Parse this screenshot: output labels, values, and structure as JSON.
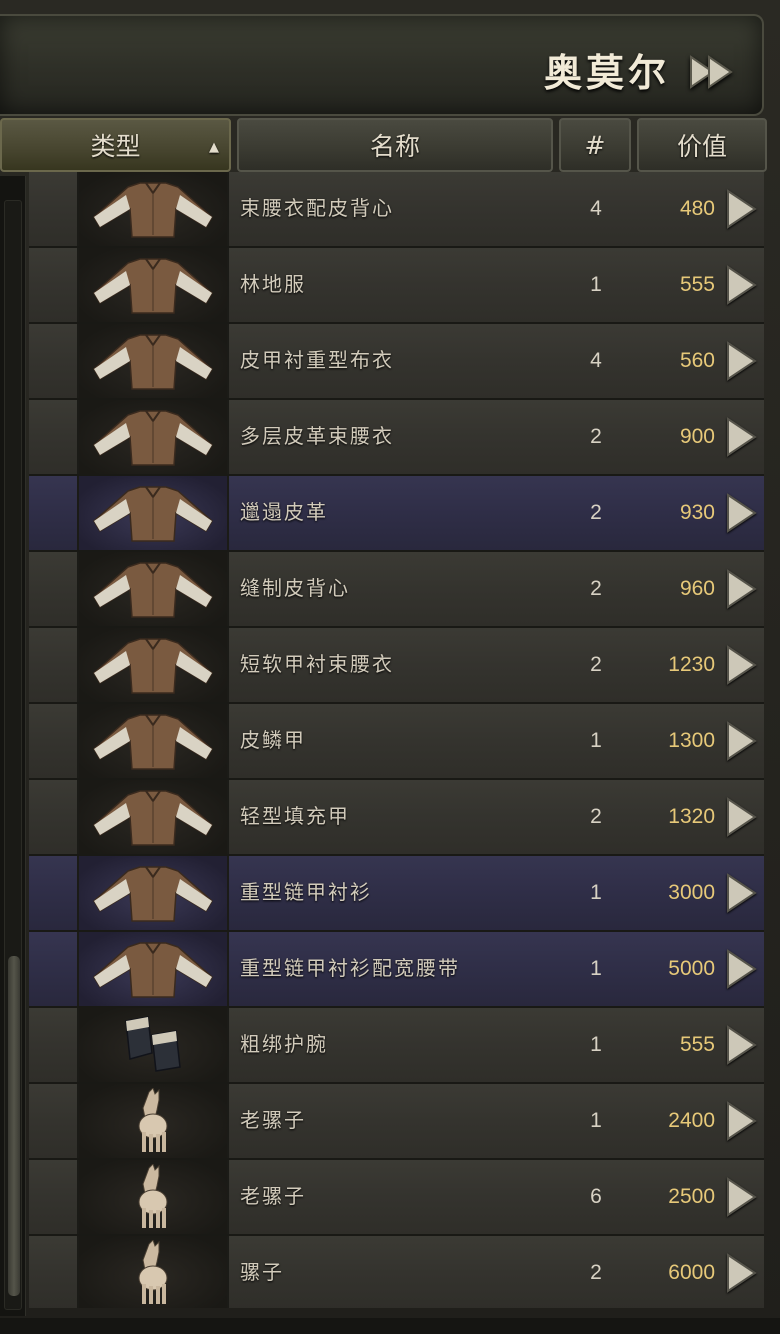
{
  "merchant": {
    "name": "奥莫尔"
  },
  "columns": {
    "type": "类型",
    "name": "名称",
    "count": "#",
    "value": "价值"
  },
  "items": [
    {
      "name": "束腰衣配皮背心",
      "count": "4",
      "value": "480",
      "icon": "tunic-icon",
      "highlight": false
    },
    {
      "name": "林地服",
      "count": "1",
      "value": "555",
      "icon": "tunic-icon",
      "highlight": false
    },
    {
      "name": "皮甲衬重型布衣",
      "count": "4",
      "value": "560",
      "icon": "tunic-icon",
      "highlight": false
    },
    {
      "name": "多层皮革束腰衣",
      "count": "2",
      "value": "900",
      "icon": "tunic-icon",
      "highlight": false
    },
    {
      "name": "邋遢皮革",
      "count": "2",
      "value": "930",
      "icon": "tunic-icon",
      "highlight": true
    },
    {
      "name": "缝制皮背心",
      "count": "2",
      "value": "960",
      "icon": "tunic-icon",
      "highlight": false
    },
    {
      "name": "短软甲衬束腰衣",
      "count": "2",
      "value": "1230",
      "icon": "tunic-icon",
      "highlight": false
    },
    {
      "name": "皮鳞甲",
      "count": "1",
      "value": "1300",
      "icon": "tunic-icon",
      "highlight": false
    },
    {
      "name": "轻型填充甲",
      "count": "2",
      "value": "1320",
      "icon": "tunic-icon",
      "highlight": false
    },
    {
      "name": "重型链甲衬衫",
      "count": "1",
      "value": "3000",
      "icon": "tunic-icon",
      "highlight": true
    },
    {
      "name": "重型链甲衬衫配宽腰带",
      "count": "1",
      "value": "5000",
      "icon": "tunic-icon",
      "highlight": true
    },
    {
      "name": "粗绑护腕",
      "count": "1",
      "value": "555",
      "icon": "bracers-icon",
      "highlight": false
    },
    {
      "name": "老骡子",
      "count": "1",
      "value": "2400",
      "icon": "mule-icon",
      "highlight": false
    },
    {
      "name": "老骡子",
      "count": "6",
      "value": "2500",
      "icon": "mule-icon",
      "highlight": false
    },
    {
      "name": "骡子",
      "count": "2",
      "value": "6000",
      "icon": "mule-icon",
      "highlight": false
    }
  ],
  "colors": {
    "value_gold": "#e7c979",
    "highlight_row": "#2f2e47",
    "normal_row": "#34332e"
  }
}
